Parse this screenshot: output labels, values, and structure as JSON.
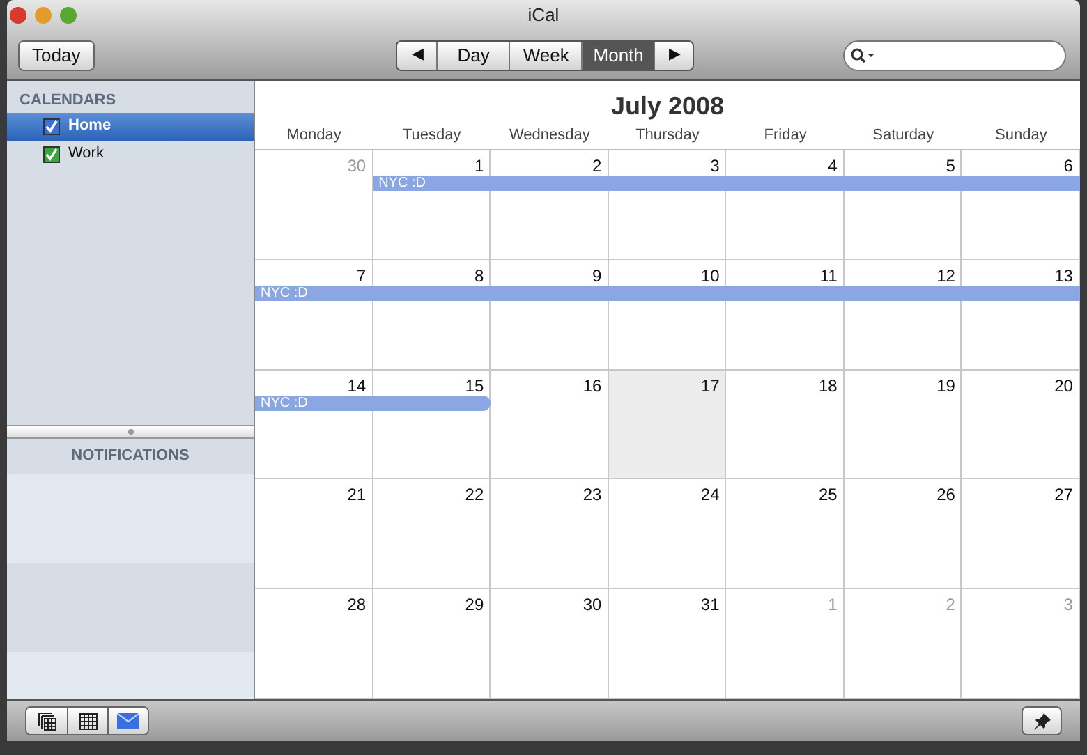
{
  "window": {
    "title": "iCal"
  },
  "toolbar": {
    "today": "Today",
    "prev": "◀",
    "next": "▶",
    "views": [
      {
        "label": "Day",
        "selected": false
      },
      {
        "label": "Week",
        "selected": false
      },
      {
        "label": "Month",
        "selected": true
      }
    ]
  },
  "sidebar": {
    "heading": "CALENDARS",
    "calendars": [
      {
        "name": "Home",
        "selected": true,
        "checked": true,
        "color": "#3d6fd6"
      },
      {
        "name": "Work",
        "selected": false,
        "checked": true,
        "color": "#3aa53a"
      }
    ],
    "notifications_heading": "NOTIFICATIONS"
  },
  "calendar": {
    "title": "July 2008",
    "weekdays": [
      "Monday",
      "Tuesday",
      "Wednesday",
      "Thursday",
      "Friday",
      "Saturday",
      "Sunday"
    ],
    "weeks": [
      {
        "event_label": "NYC :D",
        "event_ends": false,
        "days": [
          {
            "date": "30",
            "in_month": false,
            "today": false,
            "event": false
          },
          {
            "date": "1",
            "in_month": true,
            "today": false,
            "event": true
          },
          {
            "date": "2",
            "in_month": true,
            "today": false,
            "event": true
          },
          {
            "date": "3",
            "in_month": true,
            "today": false,
            "event": true
          },
          {
            "date": "4",
            "in_month": true,
            "today": false,
            "event": true
          },
          {
            "date": "5",
            "in_month": true,
            "today": false,
            "event": true
          },
          {
            "date": "6",
            "in_month": true,
            "today": false,
            "event": true
          }
        ]
      },
      {
        "event_label": "NYC :D",
        "event_ends": false,
        "days": [
          {
            "date": "7",
            "in_month": true,
            "today": false,
            "event": true
          },
          {
            "date": "8",
            "in_month": true,
            "today": false,
            "event": true
          },
          {
            "date": "9",
            "in_month": true,
            "today": false,
            "event": true
          },
          {
            "date": "10",
            "in_month": true,
            "today": false,
            "event": true
          },
          {
            "date": "11",
            "in_month": true,
            "today": false,
            "event": true
          },
          {
            "date": "12",
            "in_month": true,
            "today": false,
            "event": true
          },
          {
            "date": "13",
            "in_month": true,
            "today": false,
            "event": true
          }
        ]
      },
      {
        "event_label": "NYC :D",
        "event_ends": true,
        "days": [
          {
            "date": "14",
            "in_month": true,
            "today": false,
            "event": true
          },
          {
            "date": "15",
            "in_month": true,
            "today": false,
            "event": true
          },
          {
            "date": "16",
            "in_month": true,
            "today": false,
            "event": false
          },
          {
            "date": "17",
            "in_month": true,
            "today": true,
            "event": false
          },
          {
            "date": "18",
            "in_month": true,
            "today": false,
            "event": false
          },
          {
            "date": "19",
            "in_month": true,
            "today": false,
            "event": false
          },
          {
            "date": "20",
            "in_month": true,
            "today": false,
            "event": false
          }
        ]
      },
      {
        "days": [
          {
            "date": "21",
            "in_month": true,
            "today": false
          },
          {
            "date": "22",
            "in_month": true,
            "today": false
          },
          {
            "date": "23",
            "in_month": true,
            "today": false
          },
          {
            "date": "24",
            "in_month": true,
            "today": false
          },
          {
            "date": "25",
            "in_month": true,
            "today": false
          },
          {
            "date": "26",
            "in_month": true,
            "today": false
          },
          {
            "date": "27",
            "in_month": true,
            "today": false
          }
        ]
      },
      {
        "days": [
          {
            "date": "28",
            "in_month": true,
            "today": false
          },
          {
            "date": "29",
            "in_month": true,
            "today": false
          },
          {
            "date": "30",
            "in_month": true,
            "today": false
          },
          {
            "date": "31",
            "in_month": true,
            "today": false
          },
          {
            "date": "1",
            "in_month": false,
            "today": false
          },
          {
            "date": "2",
            "in_month": false,
            "today": false
          },
          {
            "date": "3",
            "in_month": false,
            "today": false
          }
        ]
      }
    ]
  },
  "bottom_bar": {
    "buttons": [
      {
        "kind": "calendars",
        "on": false
      },
      {
        "kind": "grid",
        "on": false
      },
      {
        "kind": "mail",
        "on": true
      }
    ]
  }
}
